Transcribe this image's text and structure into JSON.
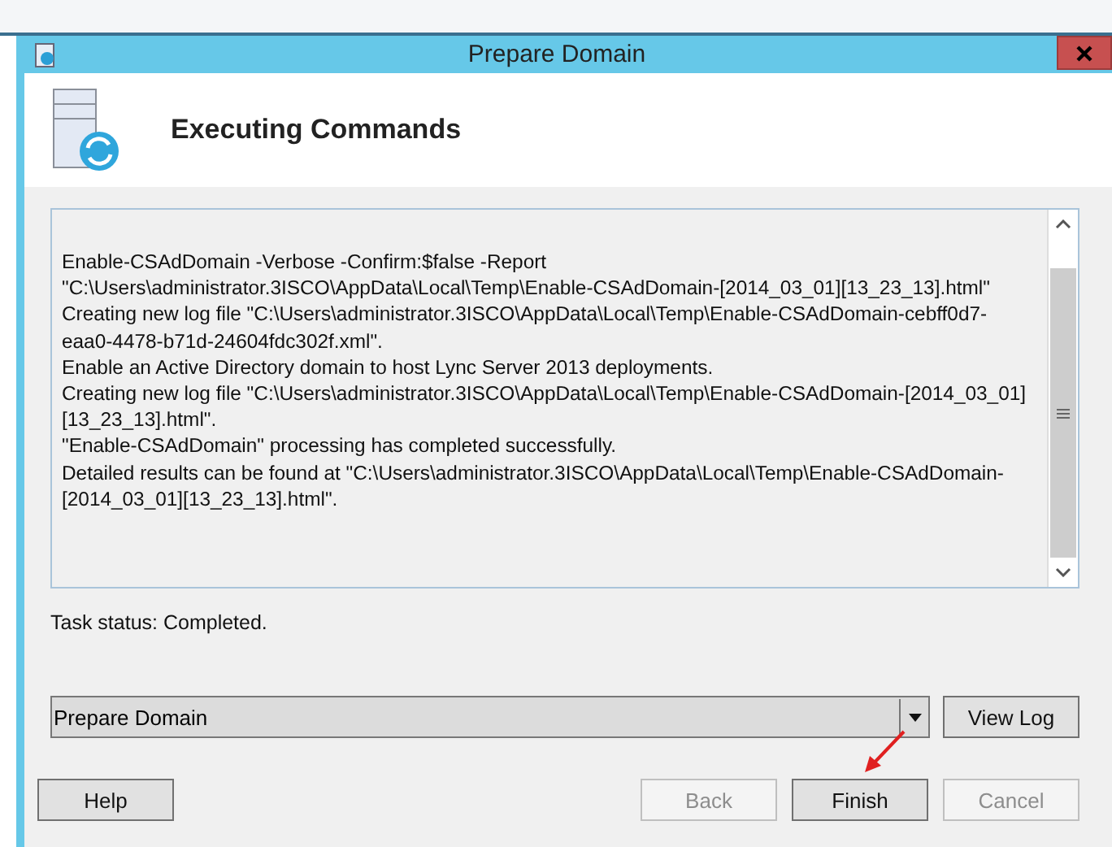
{
  "window": {
    "title": "Prepare Domain"
  },
  "header": {
    "title": "Executing Commands"
  },
  "log": {
    "lines": [
      "Enable-CSAdDomain -Verbose -Confirm:$false -Report \"C:\\Users\\administrator.3ISCO\\AppData\\Local\\Temp\\Enable-CSAdDomain-[2014_03_01][13_23_13].html\"",
      "Creating new log file \"C:\\Users\\administrator.3ISCO\\AppData\\Local\\Temp\\Enable-CSAdDomain-cebff0d7-eaa0-4478-b71d-24604fdc302f.xml\".",
      "Enable an Active Directory domain to host Lync Server 2013 deployments.",
      "Creating new log file \"C:\\Users\\administrator.3ISCO\\AppData\\Local\\Temp\\Enable-CSAdDomain-[2014_03_01][13_23_13].html\".",
      "\"Enable-CSAdDomain\" processing has completed successfully.",
      "Detailed results can be found at \"C:\\Users\\administrator.3ISCO\\AppData\\Local\\Temp\\Enable-CSAdDomain-[2014_03_01][13_23_13].html\"."
    ]
  },
  "task_status": "Task status: Completed.",
  "combo": {
    "value": "Prepare Domain"
  },
  "view_log_button": "View Log",
  "buttons": [
    {
      "label": "Help",
      "disabled": false,
      "kind": "left"
    },
    {
      "label": "Back",
      "disabled": true,
      "kind": "right"
    },
    {
      "label": "Finish",
      "disabled": false,
      "kind": "right"
    },
    {
      "label": "Cancel",
      "disabled": true,
      "kind": "right"
    }
  ]
}
